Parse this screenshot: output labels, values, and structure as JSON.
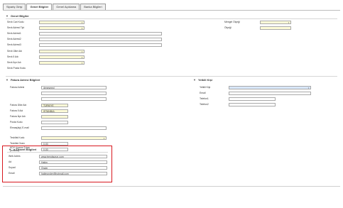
{
  "tabs": [
    "Sipariş Girişi",
    "Genel Bilgiler",
    "Genel Açıklama",
    "Banka Bilgileri"
  ],
  "sections": {
    "general": "Genel Bilgiler",
    "invoice": "Fatura Adresi Bilgileri",
    "contact": "Yetkili Kişi",
    "other": "e-Ticaret Bilgileri"
  },
  "general": {
    "sevk_cari_kodu": "Sevk Cari Kodu",
    "sevk_adresi_tipi": "Sevk Adresi Tipi",
    "sevk_adresi1": "Sevk Adresi1",
    "sevk_adresi2": "Sevk Adresi2",
    "sevk_adresi3": "Sevk Adresi3",
    "sevk_ulke_adi": "Sevk Ülke Adı",
    "sevk_il_adi": "Sevk İl Adı",
    "sevk_ilce_adi": "Sevk İlçe Adı",
    "sevk_posta_kodu": "Sevk Posta Kodu",
    "mengel_olcegi": "Mengel Ölçeği",
    "olcegi": "Ölçeği"
  },
  "invoice": {
    "fatura_adresi": "Fatura Adresi",
    "fatura_adresi_value": "deneseepi",
    "fatura_ulke_adi": "Fatura Ülke Adı",
    "fatura_ulke_value": "TÜRKİYE",
    "fatura_il_adi": "Fatura İl Adı",
    "fatura_il_value": "İSTANBUL",
    "fatura_ilce_adi": "Fatura İlçe Adı",
    "posta_kodu": "Posta Kodu",
    "elmas_email": "Elmas(alp) E-mail",
    "tevkifat_kodu": "Tevkifat Kodu",
    "tevkifat_orani": "Tevkifat Oranı",
    "tevkifat_orani_value": "0,00",
    "kdv_tutari": "KDV Uyanm Tutarı (tevkifat)",
    "kdv_tutari_value": "0,00"
  },
  "contact": {
    "yetkili_kisi": "Yetkili Kişi",
    "email": "Email",
    "telefon1": "Telefon1",
    "telefon2": "Telefon2"
  },
  "ecommerce": {
    "web_adres_label": "Web Adres",
    "web_adres_value": "www.trendsurun.com",
    "ad_label": "Ad",
    "ad_value": "Hatim",
    "soyad_label": "Soyad",
    "soyad_value": "Önder",
    "email_label": "Email",
    "email_value": "hatimonder@hotmail.com"
  },
  "colors": {
    "highlight_border": "#d8181e",
    "required_bg": "#fdfbd7",
    "selected_bg": "#d8e7fb"
  }
}
